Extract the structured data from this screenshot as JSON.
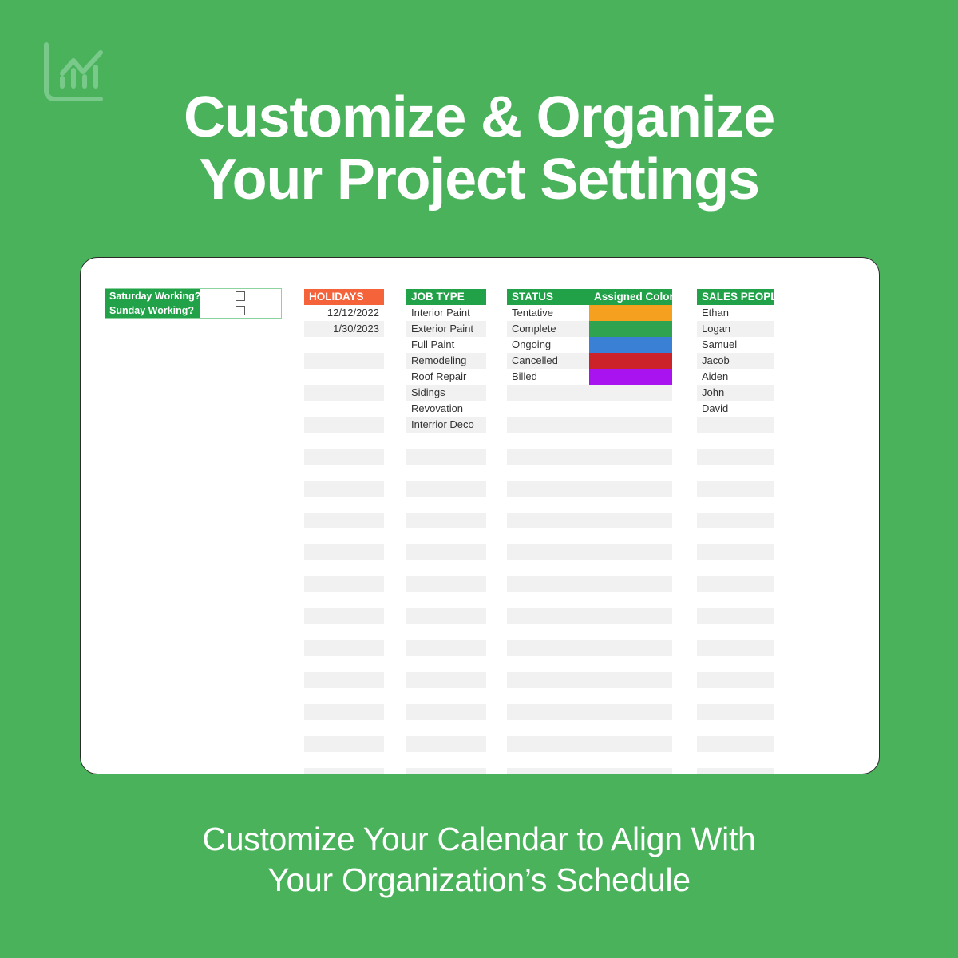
{
  "brand": {
    "logo_icon": "bar-chart-line-icon",
    "background_color": "#4BB25C",
    "header_green": "#21A148",
    "header_orange": "#F4633A"
  },
  "hero": {
    "line1": "Customize & Organize",
    "line2": "Your Project Settings"
  },
  "caption": {
    "line1": "Customize Your Calendar to Align With",
    "line2": "Your Organization’s Schedule"
  },
  "sheet": {
    "working_days": {
      "rows": [
        {
          "label": "Saturday Working?",
          "checked": false
        },
        {
          "label": "Sunday Working?",
          "checked": false
        }
      ]
    },
    "holidays": {
      "header": "HOLIDAYS",
      "header_color": "#F4633A",
      "values": [
        "12/12/2022",
        "1/30/2023"
      ]
    },
    "job_type": {
      "header": "JOB TYPE",
      "header_color": "#21A148",
      "values": [
        "Interior Paint",
        "Exterior Paint",
        "Full Paint",
        "Remodeling",
        "Roof Repair",
        "Sidings",
        "Revovation",
        "Interrior Deco"
      ]
    },
    "status": {
      "header": "STATUS",
      "color_header": "Assigned Color",
      "header_color": "#21A148",
      "rows": [
        {
          "label": "Tentative",
          "color": "#F5A01E"
        },
        {
          "label": "Complete",
          "color": "#2FA34F"
        },
        {
          "label": "Ongoing",
          "color": "#3A80D4"
        },
        {
          "label": "Cancelled",
          "color": "#CC2229"
        },
        {
          "label": "Billed",
          "color": "#A913F0"
        }
      ]
    },
    "sales_people": {
      "header": "SALES PEOPLE",
      "header_color": "#21A148",
      "values": [
        "Ethan",
        "Logan",
        "Samuel",
        "Jacob",
        "Aiden",
        "John",
        "David"
      ]
    }
  }
}
